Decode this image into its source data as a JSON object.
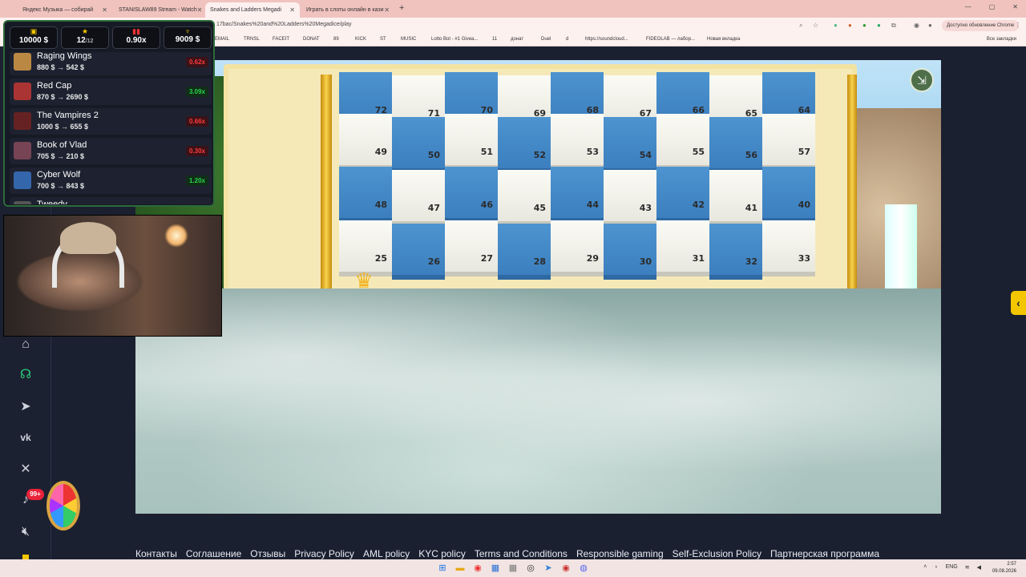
{
  "browser": {
    "tabs": [
      {
        "title": "Яндекс Музыка — собирай"
      },
      {
        "title": "STANISLAW89 Stream - Watch"
      },
      {
        "title": "Snakes and Ladders Megadi"
      },
      {
        "title": "Играть в слоты онлайн в кази"
      }
    ],
    "new_tab": "+",
    "window_controls": [
      "—",
      "▢",
      "✕"
    ],
    "url": "17bac/Snakes%20and%20Ladders%20Megadice/play",
    "update_chip": "Доступно обновление Chrome",
    "bookmarks": [
      "EMAIL",
      "TRNSL",
      "FACEIT",
      "DONAT",
      "89",
      "KICK",
      "ST",
      "MUSIC",
      "Lotto Bot - #1 Givea...",
      "11",
      "донат",
      "Duel",
      "d",
      "https://soundcloud...",
      "FIDEOLAB — лабор...",
      "Новая вкладка"
    ],
    "all_bookmarks": "Все закладки"
  },
  "overlay": {
    "stats": [
      {
        "icon": "wallet-icon",
        "value": "10000 $"
      },
      {
        "icon": "star-icon",
        "value": "12",
        "sub": "/12"
      },
      {
        "icon": "chart-icon",
        "value": "0.90x"
      },
      {
        "icon": "trophy-icon",
        "value": "9009 $"
      }
    ],
    "slots": [
      {
        "name": "Raging Wings",
        "amount": "880 $ → 542 $",
        "multiplier": "0.62x",
        "result": "red"
      },
      {
        "name": "Red Cap",
        "amount": "870 $ → 2690 $",
        "multiplier": "3.09x",
        "result": "green"
      },
      {
        "name": "The Vampires 2",
        "amount": "1000 $ → 655 $",
        "multiplier": "0.66x",
        "result": "red"
      },
      {
        "name": "Book of Vlad",
        "amount": "705 $ → 210 $",
        "multiplier": "0.30x",
        "result": "red"
      },
      {
        "name": "Cyber Wolf",
        "amount": "700 $ → 843 $",
        "multiplier": "1.20x",
        "result": "green"
      },
      {
        "name": "Tweedy",
        "amount": "",
        "multiplier": "",
        "result": ""
      }
    ]
  },
  "game": {
    "board_rows": [
      [
        72,
        71,
        70,
        69,
        68,
        67,
        66,
        65,
        64
      ],
      [
        49,
        50,
        51,
        52,
        53,
        54,
        55,
        56,
        57
      ],
      [
        48,
        47,
        46,
        45,
        44,
        43,
        42,
        41,
        40
      ],
      [
        25,
        26,
        27,
        28,
        29,
        30,
        31,
        32,
        33
      ]
    ],
    "exit_icon": "exit-icon"
  },
  "footer": {
    "links": [
      "Контакты",
      "Соглашение",
      "Отзывы",
      "Privacy Policy",
      "AML policy",
      "KYC policy",
      "Terms and Conditions",
      "Responsible gaming",
      "Self-Exclusion Policy",
      "Партнерская программа"
    ]
  },
  "sidebar": {
    "notification_count": "99+"
  },
  "taskbar": {
    "language": "ENG",
    "time": "2:57",
    "date": "09.08.2026"
  },
  "colors": {
    "accent": "#f4c600",
    "site_bg": "#1b2030",
    "board_blue": "#3a7dbd",
    "positive": "#2bd24d",
    "negative": "#ff3b3b"
  }
}
